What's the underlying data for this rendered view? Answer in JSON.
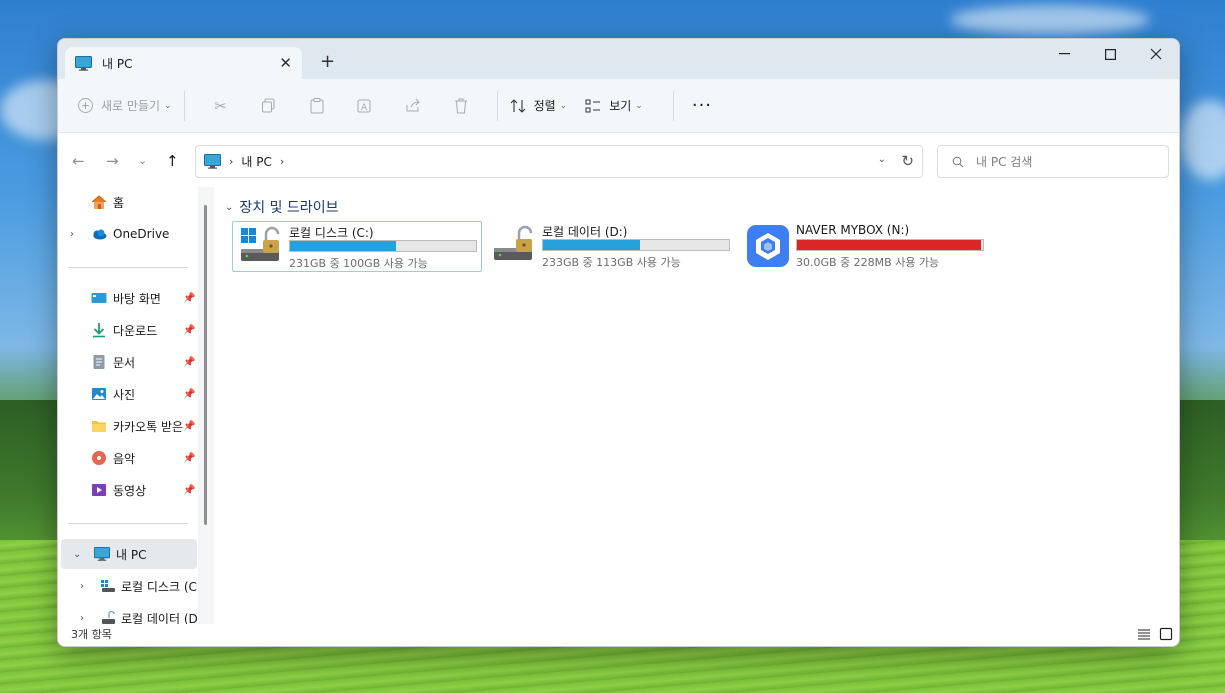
{
  "tab": {
    "title": "내 PC",
    "new_tab_symbol": "+"
  },
  "window_controls": {
    "minimize": "—",
    "maximize": "☐",
    "close": "✕"
  },
  "toolbar": {
    "new_label": "새로 만들기",
    "sort_label": "정렬",
    "view_label": "보기",
    "more_label": "···"
  },
  "address": {
    "crumbs": [
      "내 PC"
    ],
    "search_placeholder": "내 PC 검색"
  },
  "sidebar": {
    "home": "홈",
    "onedrive": "OneDrive",
    "quick_access": [
      {
        "label": "바탕 화면",
        "icon": "desktop-icon"
      },
      {
        "label": "다운로드",
        "icon": "download-icon"
      },
      {
        "label": "문서",
        "icon": "document-icon"
      },
      {
        "label": "사진",
        "icon": "pictures-icon"
      },
      {
        "label": "카카오톡 받은",
        "icon": "folder-icon"
      },
      {
        "label": "음악",
        "icon": "music-icon"
      },
      {
        "label": "동영상",
        "icon": "video-icon"
      }
    ],
    "this_pc": "내 PC",
    "drives": [
      "로컬 디스크 (C",
      "로컬 데이터 (D"
    ]
  },
  "content": {
    "group_header": "장치 및 드라이브",
    "drives": [
      {
        "name": "로컬 디스크 (C:)",
        "free_text": "231GB 중 100GB 사용 가능",
        "used_fraction": 0.57,
        "bar_color": "#26a0da"
      },
      {
        "name": "로컬 데이터 (D:)",
        "free_text": "233GB 중 113GB 사용 가능",
        "used_fraction": 0.52,
        "bar_color": "#26a0da"
      },
      {
        "name": "NAVER MYBOX (N:)",
        "free_text": "30.0GB 중 228MB 사용 가능",
        "used_fraction": 0.99,
        "bar_color": "#da2626"
      }
    ]
  },
  "status": {
    "item_count": "3개 항목"
  },
  "colors": {
    "accent": "#26a0da",
    "warning": "#da2626",
    "selection": "#9ccbee"
  }
}
